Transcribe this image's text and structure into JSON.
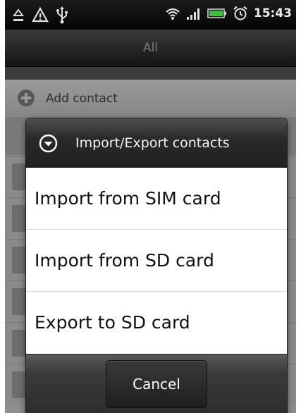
{
  "status_bar": {
    "time": "15:43",
    "left_icons": [
      "missed-alert-icon",
      "warning-triangle-icon",
      "usb-icon"
    ],
    "right_icons": [
      "wifi-icon",
      "signal-icon",
      "battery-icon",
      "alarm-icon"
    ]
  },
  "title_bar": {
    "title": "All"
  },
  "contact_list": {
    "add_contact_label": "Add contact"
  },
  "dialog": {
    "title": "Import/Export contacts",
    "header_icon": "chevron-down-circle-icon",
    "options": [
      {
        "label": "Import from SIM card"
      },
      {
        "label": "Import from SD card"
      },
      {
        "label": "Export to SD card"
      }
    ],
    "cancel_label": "Cancel"
  },
  "colors": {
    "dialog_header": "#2a2a2a",
    "dialog_body": "#ffffff",
    "status_bar": "#0a0a0a",
    "battery": "#3fbf3f"
  }
}
